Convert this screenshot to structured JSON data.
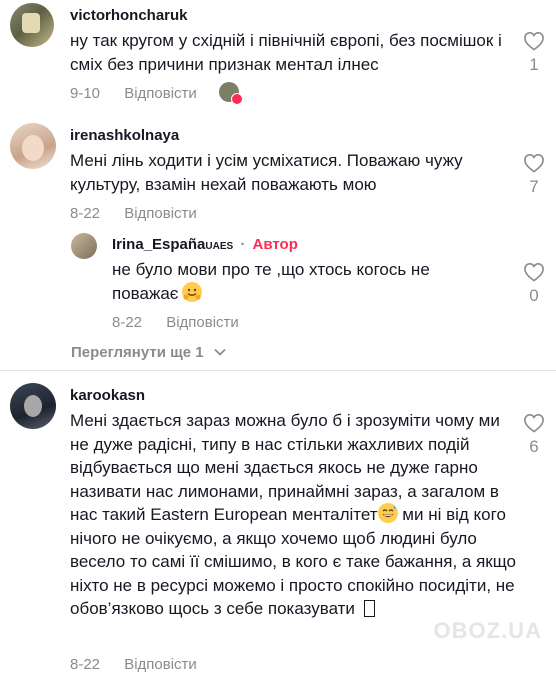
{
  "reply_label": "Відповісти",
  "comments": [
    {
      "username": "victorhoncharuk",
      "text": "ну так кругом у східній і північній європі, без посмішок і сміх без причини признак ментал ілнес",
      "date": "9-10",
      "likes": "1"
    },
    {
      "username": "irenashkolnaya",
      "text": "Мені лінь ходити і усім усміхатися. Поважаю чужу культуру, взамін нехай поважають мою",
      "date": "8-22",
      "likes": "7",
      "reply": {
        "username": "Irina_España",
        "username_suffix": "UAES",
        "author_badge": "Автор",
        "text": "не було мови про те ,що хтось когось не поважає",
        "date": "8-22",
        "likes": "0"
      },
      "view_more": "Переглянути ще 1"
    },
    {
      "username": "karookasn",
      "text": "Мені здається зараз можна було б і зрозуміти чому ми не дуже радісні, типу в нас стільки жахливих подій відбувається що мені здається якось не дуже гарно називати нас лимонами, принаймні зараз, а загалом в нас такий Eastern European менталітет",
      "text_cont": " ми ні від кого нічого не очікуємо, а якщо хочемо щоб людині було весело то самі її смішимо, в кого є таке бажання, а якщо ніхто не в ресурсі можемо і просто спокійно посидіти, не обов’язково щось з себе показувати",
      "date": "8-22",
      "likes": "6"
    }
  ],
  "watermark": "OBOZ.UA"
}
